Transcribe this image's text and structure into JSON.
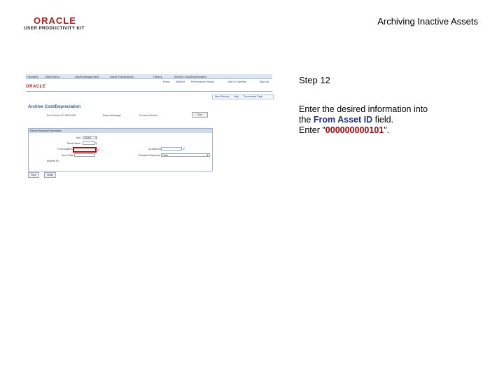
{
  "logo": {
    "brand": "ORACLE",
    "tagline": "USER PRODUCTIVITY KIT"
  },
  "doc_title": "Archiving Inactive Assets",
  "step": "Step 12",
  "instruction": {
    "line1": "Enter the desired information into",
    "line2_prefix": "the ",
    "field_name": "From Asset ID",
    "line2_suffix": " field.",
    "line3_prefix": "Enter \"",
    "value": "000000000101",
    "line3_suffix": "\"."
  },
  "screenshot": {
    "nav": [
      "Favorites",
      "Main Menu",
      "Asset Management",
      "Asset Transactions",
      "History",
      "Archive Cost/Depreciation"
    ],
    "mini_logo": "ORACLE",
    "top_links": [
      "Home",
      "Worklist",
      "Performance Monitor",
      "Add to Favorites",
      "Sign out"
    ],
    "new_window": [
      "New Window",
      "Help",
      "Personalize Page"
    ],
    "page_title": "Archive Cost/Depreciation",
    "tabs": [
      "Run Control ID: ARCHIVE",
      "Report Manager",
      "Process Monitor"
    ],
    "run_button": "Run",
    "group_header": "Report Request Parameters",
    "labels": {
      "unit": "Unit",
      "book": "Book Name",
      "from_asset": "From Asset ID",
      "to_asset": "To Asset ID",
      "process_freq": "Process Frequency",
      "as_of_date": "As of Date",
      "archive_id": "Archive ID"
    },
    "values": {
      "unit": "US001",
      "process_freq": "Once"
    },
    "buttons": [
      "Save",
      "Notify"
    ]
  }
}
